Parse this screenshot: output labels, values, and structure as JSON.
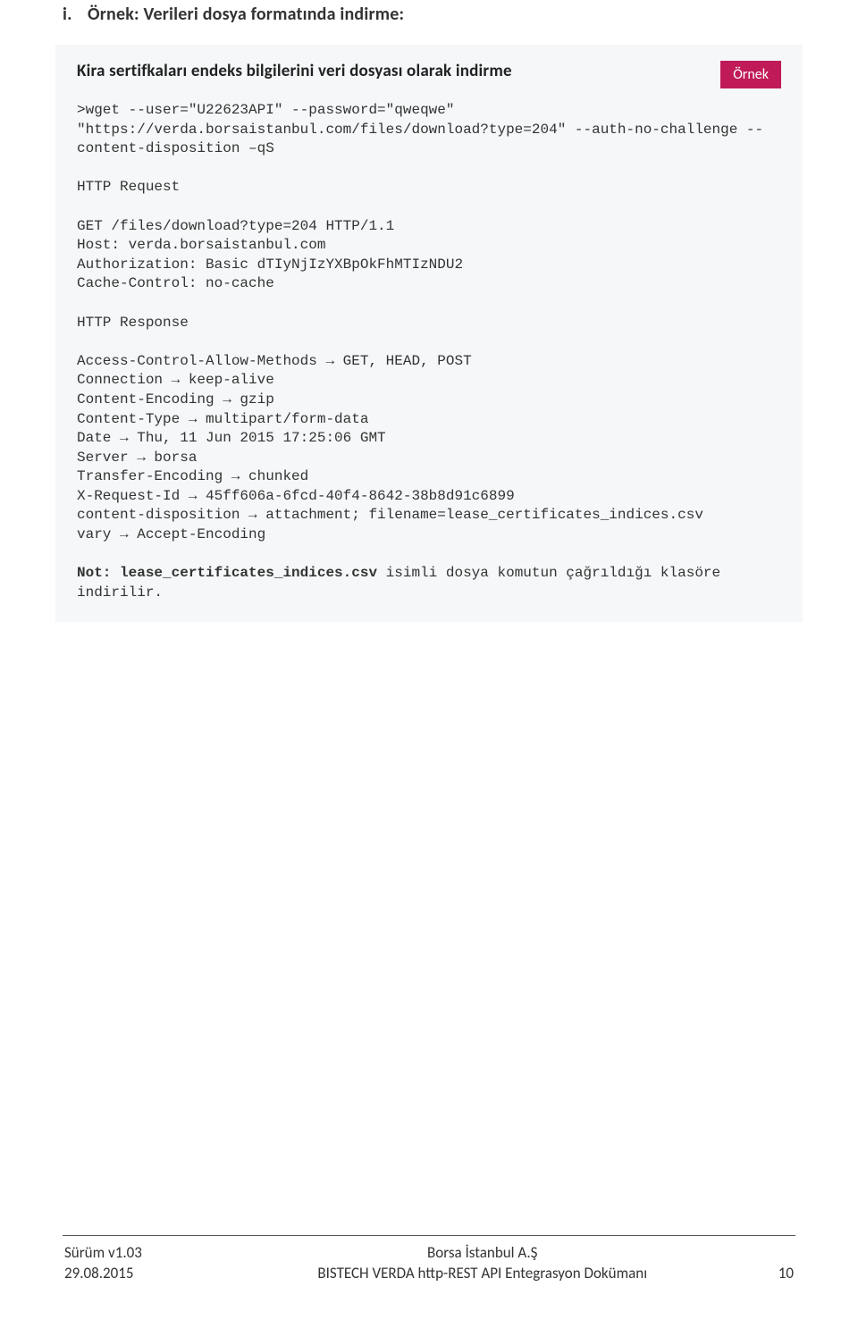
{
  "heading": {
    "num": "i.",
    "text": "Örnek: Verileri dosya formatında indirme:"
  },
  "example": {
    "title": "Kira sertifkaları endeks bilgilerini veri dosyası olarak indirme",
    "badge": "Örnek",
    "c1": ">wget --user=\"U22623API\" --password=\"qweqwe\" \"https://verda.borsaistanbul.com/files/download?type=204\" --auth-no-challenge --content-disposition –qS",
    "h1": "HTTP Request",
    "c2": "GET /files/download?type=204 HTTP/1.1\nHost: verda.borsaistanbul.com\nAuthorization: Basic dTIyNjIzYXBpOkFhMTIzNDU2\nCache-Control: no-cache",
    "h2": "HTTP Response",
    "c3": "Access-Control-Allow-Methods → GET, HEAD, POST\nConnection → keep-alive\nContent-Encoding → gzip\nContent-Type → multipart/form-data\nDate → Thu, 11 Jun 2015 17:25:06 GMT\nServer → borsa\nTransfer-Encoding → chunked\nX-Request-Id → 45ff606a-6fcd-40f4-8642-38b8d91c6899\ncontent-disposition → attachment; filename=lease_certificates_indices.csv\nvary → Accept-Encoding",
    "note_b": "Not: lease_certificates_indices.csv",
    "note_r": " isimli dosya komutun çağrıldığı klasöre indirilir."
  },
  "footer": {
    "l1": "Sürüm v1.03",
    "l2": "29.08.2015",
    "c1": "Borsa İstanbul A.Ş",
    "c2": "BISTECH VERDA http-REST API Entegrasyon Dokümanı",
    "page": "10"
  }
}
